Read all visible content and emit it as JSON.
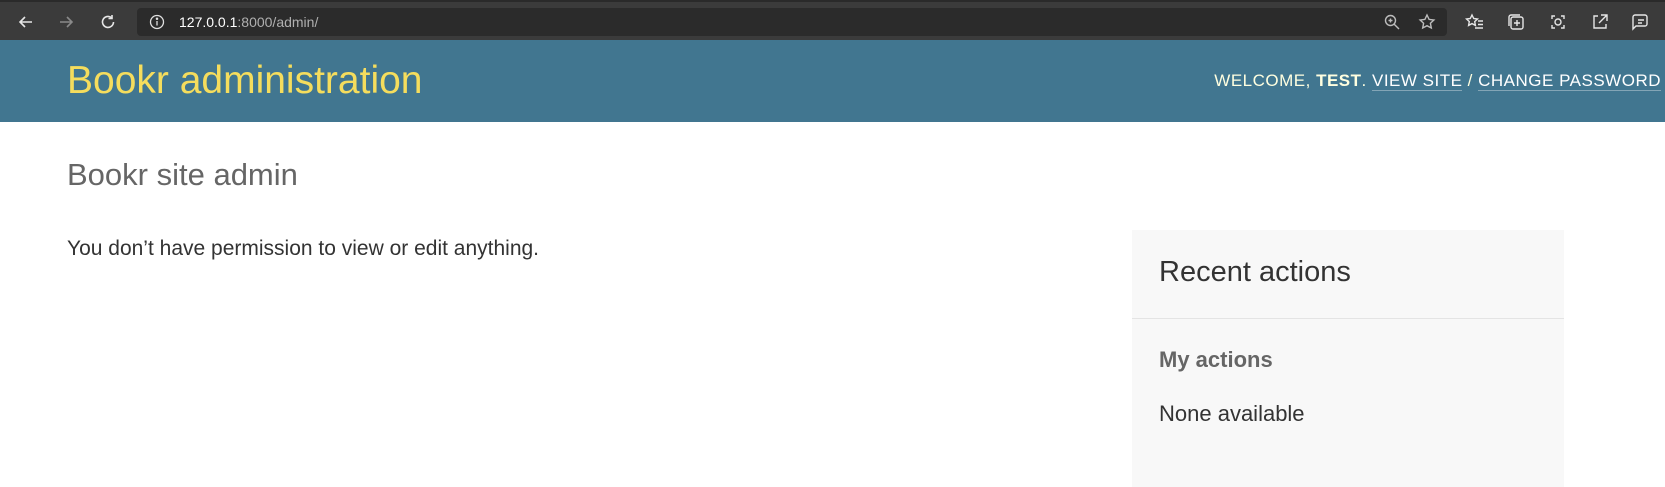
{
  "browser": {
    "url_host": "127.0.0.1",
    "url_path": ":8000/admin/",
    "icons": {
      "back": "back-arrow-icon",
      "forward": "forward-arrow-icon",
      "reload": "reload-icon",
      "site_info": "info-icon",
      "zoom": "zoom-icon",
      "favorite": "star-icon",
      "favorites_list": "favorites-icon",
      "collections": "collections-icon",
      "extensions": "extensions-icon",
      "share": "share-icon",
      "feedback": "feedback-icon"
    }
  },
  "header": {
    "branding": "Bookr administration",
    "welcome_prefix": "WELCOME, ",
    "username": "TEST",
    "welcome_suffix": ". ",
    "view_site": "VIEW SITE",
    "separator": " / ",
    "change_password": "CHANGE PASSWORD"
  },
  "main": {
    "title": "Bookr site admin",
    "permission_message": "You don’t have permission to view or edit anything."
  },
  "recent_actions": {
    "title": "Recent actions",
    "my_actions_title": "My actions",
    "empty_text": "None available"
  },
  "colors": {
    "header_bg": "#417690",
    "branding": "#f5dd5d",
    "module_bg": "#f8f8f8"
  }
}
